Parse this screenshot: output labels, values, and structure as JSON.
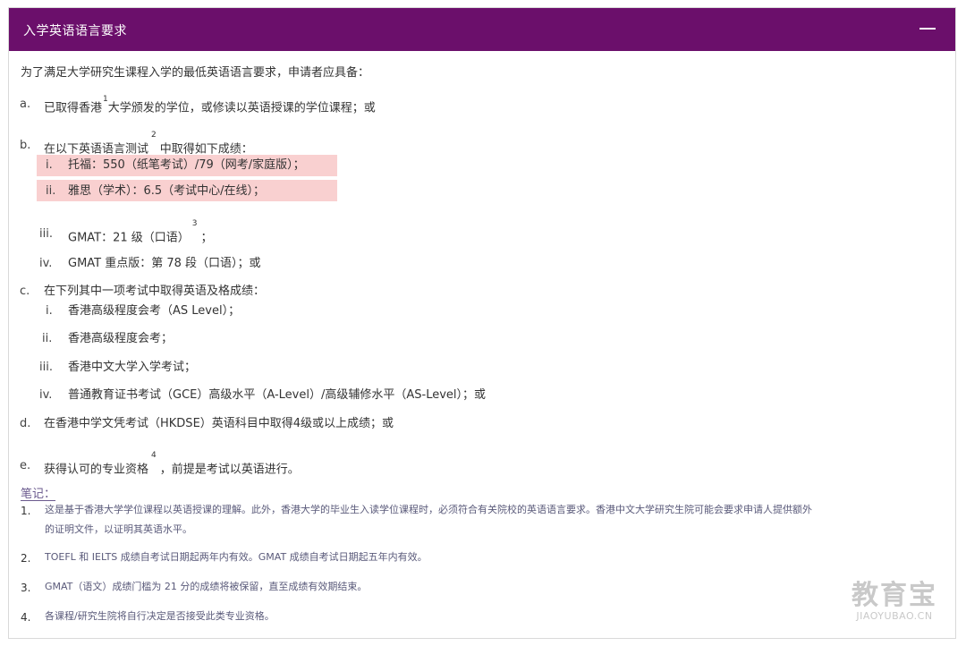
{
  "header": {
    "title": "入学英语语言要求"
  },
  "intro": "为了满足大学研究生课程入学的最低英语语言要求，申请者应具备：",
  "items": {
    "a": {
      "marker": "a.",
      "text": "已取得香港",
      "sup": "1",
      "text_after": "大学颁发的学位，或修读以英语授课的学位课程；或"
    },
    "b": {
      "marker": "b.",
      "text": "在以下英语语言测试",
      "sup": "2",
      "text_after": "中取得如下成绩：",
      "sub": [
        {
          "marker": "i.",
          "text": "托福：550（纸笔考试）/79（网考/家庭版）；"
        },
        {
          "marker": "ii.",
          "text": "雅思（学术）：6.5（考试中心/在线）；"
        },
        {
          "marker": "iii.",
          "text": "GMAT：21 级（口语）",
          "sup": "3",
          "text_after": "；"
        },
        {
          "marker": "iv.",
          "text": "GMAT 重点版：第 78 段（口语）；或"
        }
      ]
    },
    "c": {
      "marker": "c.",
      "text": "在下列其中一项考试中取得英语及格成绩：",
      "sub": [
        {
          "marker": "i.",
          "text": "香港高级程度会考（AS Level）；"
        },
        {
          "marker": "ii.",
          "text": "香港高级程度会考；"
        },
        {
          "marker": "iii.",
          "text": "香港中文大学入学考试；"
        },
        {
          "marker": "iv.",
          "text": "普通教育证书考试（GCE）高级水平（A-Level）/高级辅修水平（AS-Level）；或"
        }
      ]
    },
    "d": {
      "marker": "d.",
      "text": "在香港中学文凭考试（HKDSE）英语科目中取得4级或以上成绩；或"
    },
    "e": {
      "marker": "e.",
      "text": "获得认可的专业资格",
      "sup": "4",
      "text_after": "，前提是考试以英语进行。"
    }
  },
  "notes": {
    "title": "笔记：",
    "list": [
      {
        "num": "1.",
        "line1": "这是基于香港大学学位课程以英语授课的理解。此外，香港大学的毕业生入读学位课程时，必须符合有关院校的英语语言要求。香港中文大学研究生院可能会要求申请人提供额外",
        "line2": "的证明文件，以证明其英语水平。"
      },
      {
        "num": "2.",
        "line1": "TOEFL 和 IELTS 成绩自考试日期起两年内有效。GMAT 成绩自考试日期起五年内有效。"
      },
      {
        "num": "3.",
        "line1": "GMAT（语文）成绩门槛为 21 分的成绩将被保留，直至成绩有效期结束。"
      },
      {
        "num": "4.",
        "line1": "各课程/研究生院将自行决定是否接受此类专业资格。"
      }
    ]
  },
  "watermark": {
    "cn": "教育宝",
    "en": "JIAOYUBAO.CN"
  }
}
